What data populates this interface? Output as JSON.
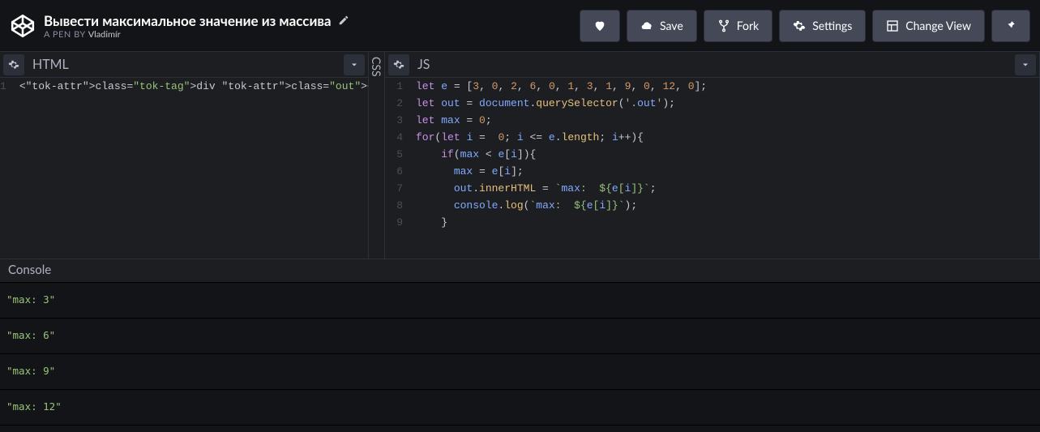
{
  "header": {
    "title": "Вывести максимальное значение из массива",
    "byline_prefix": "A PEN BY",
    "author": "Vladimír"
  },
  "toolbar": {
    "save": "Save",
    "fork": "Fork",
    "settings": "Settings",
    "changeView": "Change View"
  },
  "panels": {
    "html_label": "HTML",
    "css_label": "CSS",
    "js_label": "JS"
  },
  "code": {
    "html_lines": [
      "<div class=\"out\"></div>"
    ],
    "js_lines": [
      "let e = [3, 0, 2, 6, 0, 1, 3, 1, 9, 0, 12, 0];",
      "let out = document.querySelector('.out');",
      "let max = 0;",
      "for(let i =  0; i <= e.length; i++){",
      "    if(max < e[i]){",
      "      max = e[i];",
      "      out.innerHTML = `max:  ${e[i]}`;",
      "      console.log(`max:  ${e[i]}`);",
      "    }"
    ]
  },
  "console": {
    "label": "Console",
    "lines": [
      "\"max:  3\"",
      "\"max:  6\"",
      "\"max:  9\"",
      "\"max:  12\""
    ]
  }
}
